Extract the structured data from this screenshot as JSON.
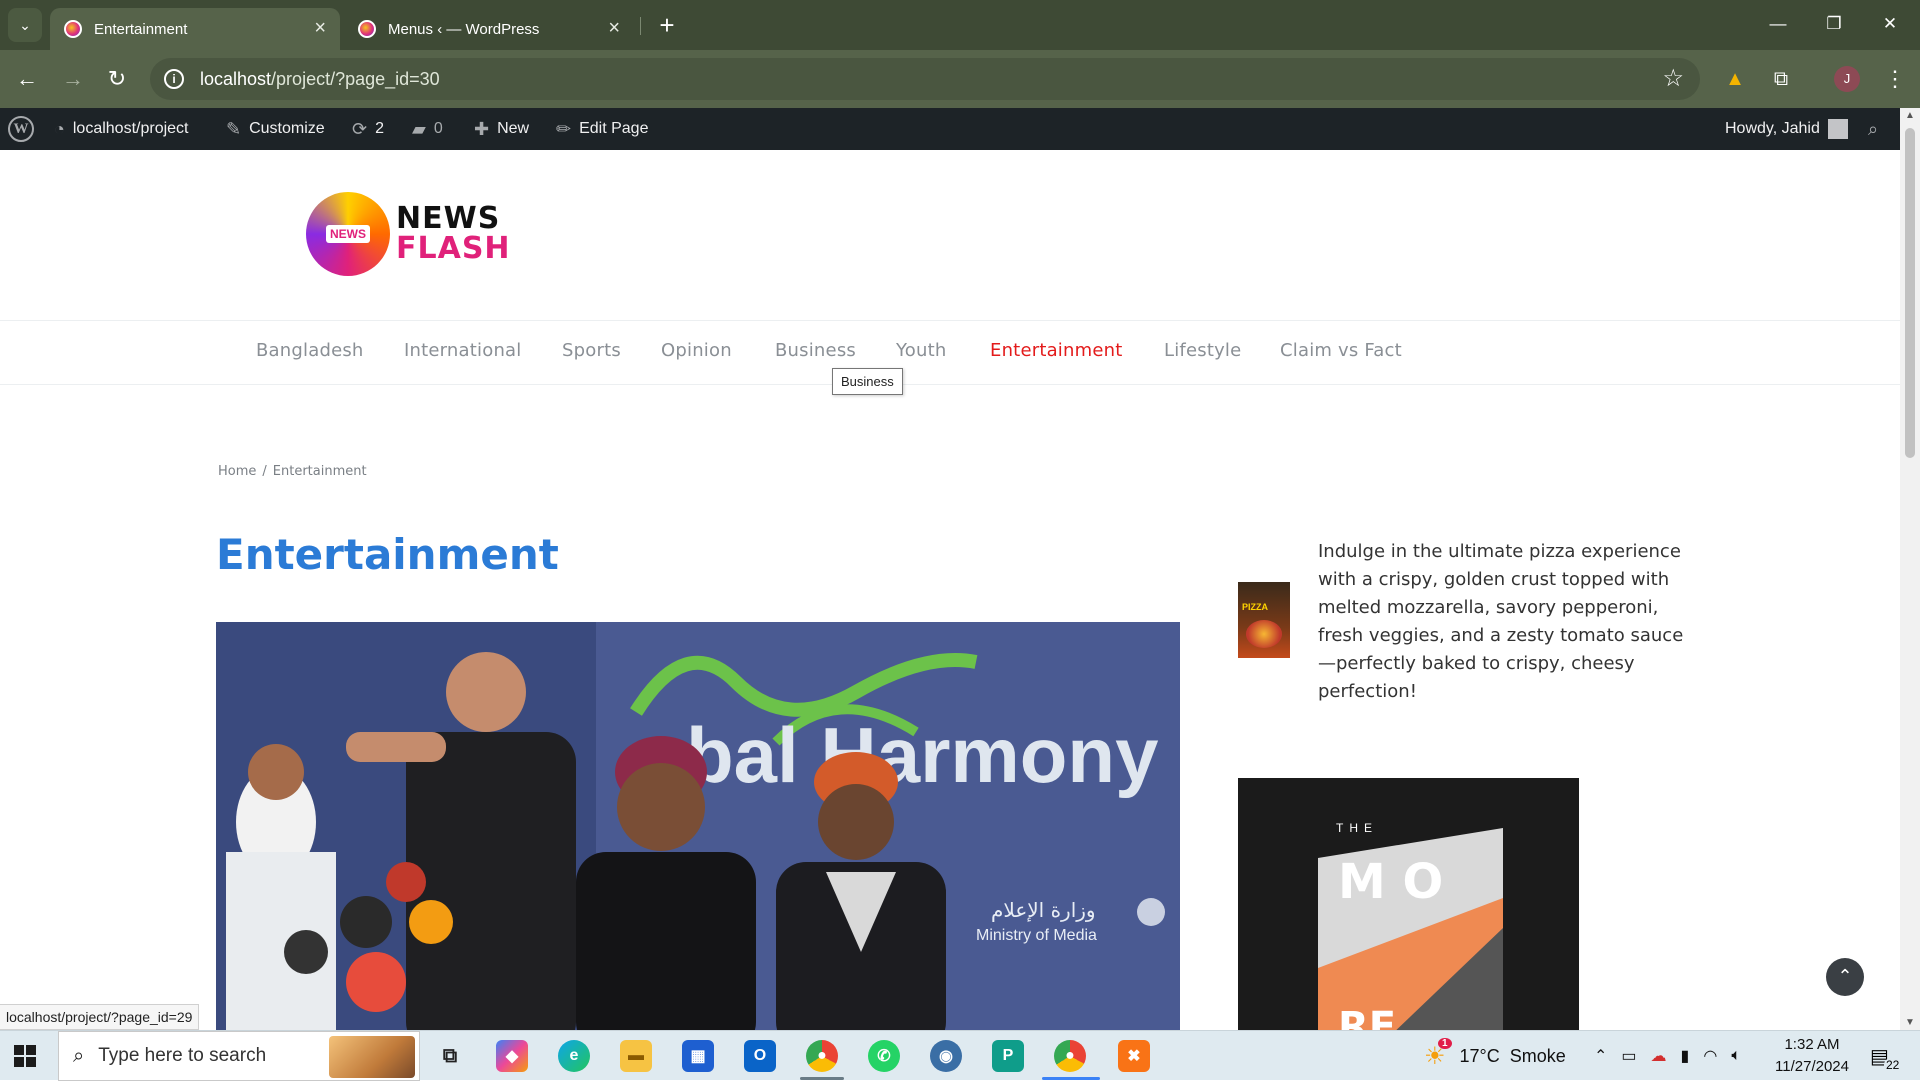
{
  "browser": {
    "tabs": [
      {
        "title": "Entertainment",
        "active": true
      },
      {
        "title": "Menus ‹ — WordPress",
        "active": false
      }
    ],
    "url_host": "localhost",
    "url_path": "/project/?page_id=30",
    "profile_initial": "J"
  },
  "adminbar": {
    "site": "localhost/project",
    "customize": "Customize",
    "updates": "2",
    "comments": "0",
    "new": "New",
    "edit": "Edit Page",
    "howdy": "Howdy, Jahid"
  },
  "site": {
    "logo": {
      "badge": "NEWS",
      "line1": "NEWS",
      "line2": "FLASH"
    },
    "menu": [
      {
        "label": "Bangladesh",
        "current": false
      },
      {
        "label": "International",
        "current": false
      },
      {
        "label": "Sports",
        "current": false
      },
      {
        "label": "Opinion",
        "current": false
      },
      {
        "label": "Business",
        "current": false
      },
      {
        "label": "Youth",
        "current": false
      },
      {
        "label": "Entertainment",
        "current": true
      },
      {
        "label": "Lifestyle",
        "current": false
      },
      {
        "label": "Claim vs Fact",
        "current": false
      }
    ],
    "tooltip": "Business",
    "breadcrumb": {
      "home": "Home",
      "sep": "/",
      "current": "Entertainment"
    },
    "page_title": "Entertainment",
    "hero": {
      "banner_text": "bal Harmony",
      "arabic": "وزارة الإعلام",
      "ministry": "Ministry of Media"
    },
    "sidebar": {
      "pizza_label": "PIZZA",
      "text": "Indulge in the ultimate pizza experience with a crispy, golden crust topped with melted mozzarella, savory pepperoni, fresh veggies, and a zesty tomato sauce—perfectly baked to crispy, cheesy perfection!",
      "ad_top": "THE",
      "ad_letters": "M O",
      "ad_bottom": "RE"
    },
    "status_url": "localhost/project/?page_id=29"
  },
  "taskbar": {
    "search_placeholder": "Type here to search",
    "weather_temp": "17°C",
    "weather_desc": "Smoke",
    "time": "1:32 AM",
    "date": "11/27/2024",
    "notif_count": "22",
    "weather_badge": "1"
  },
  "colors": {
    "accent_red": "#e31b1b",
    "title_blue": "#2b7bd6",
    "chrome_green": "#56634a",
    "adminbar": "#1d2327"
  }
}
